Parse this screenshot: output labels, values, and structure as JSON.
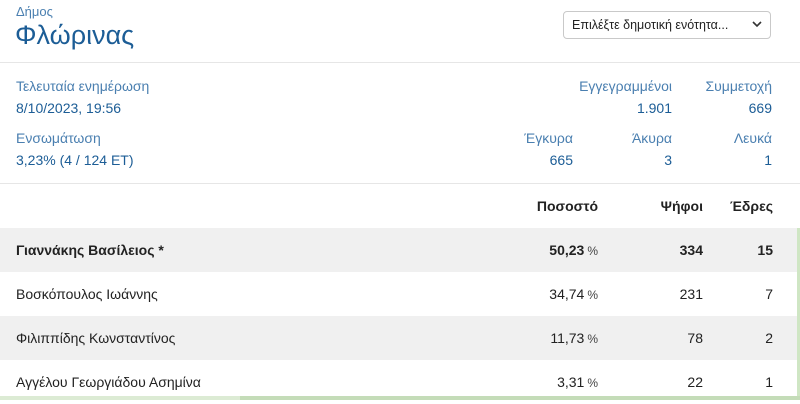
{
  "header": {
    "label": "Δήμος",
    "name": "Φλώρινας",
    "select_placeholder": "Επιλέξτε δημοτική ενότητα..."
  },
  "info": {
    "last_update_label": "Τελευταία ενημέρωση",
    "last_update_value": "8/10/2023, 19:56",
    "registered_label": "Εγγεγραμμένοι",
    "registered_value": "1.901",
    "turnout_label": "Συμμετοχή",
    "turnout_value": "669",
    "integration_label": "Ενσωμάτωση",
    "integration_value": "3,23% (4 / 124 ΕΤ)",
    "valid_label": "Έγκυρα",
    "valid_value": "665",
    "invalid_label": "Άκυρα",
    "invalid_value": "3",
    "blank_label": "Λευκά",
    "blank_value": "1"
  },
  "table": {
    "headers": {
      "percent": "Ποσοστό",
      "votes": "Ψήφοι",
      "seats": "Έδρες"
    },
    "percent_sign": "%",
    "rows": [
      {
        "name": "Γιαννάκης Βασίλειος *",
        "percent": "50,23",
        "votes": "334",
        "seats": "15"
      },
      {
        "name": "Βοσκόπουλος Ιωάννης",
        "percent": "34,74",
        "votes": "231",
        "seats": "7"
      },
      {
        "name": "Φιλιππίδης Κωνσταντίνος",
        "percent": "11,73",
        "votes": "78",
        "seats": "2"
      },
      {
        "name": "Αγγέλου Γεωργιάδου Ασημίνα",
        "percent": "3,31",
        "votes": "22",
        "seats": "1"
      }
    ]
  },
  "colors": {
    "accent": "#1c5d96",
    "label": "#4a7fb0",
    "row_shade": "#f0f0f0"
  }
}
